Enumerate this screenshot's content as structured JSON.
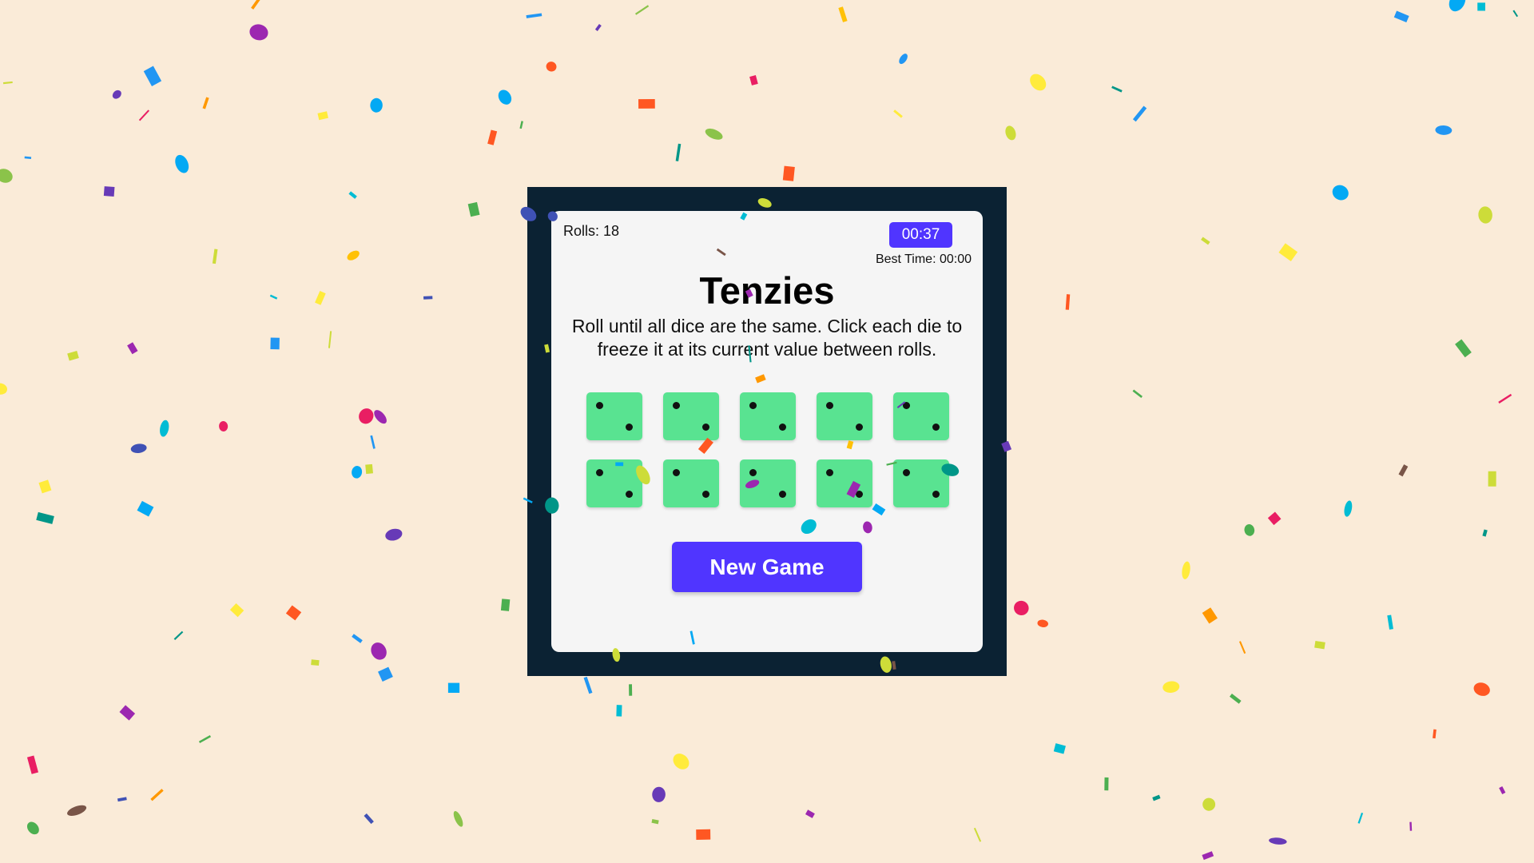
{
  "game": {
    "rolls_label": "Rolls: 18",
    "timer": "00:37",
    "best_time_label": "Best Time: 00:00",
    "title": "Tenzies",
    "instructions": "Roll until all dice are the same. Click each die to freeze it at its current value between rolls.",
    "new_game_label": "New Game"
  },
  "dice": [
    {
      "value": 2,
      "held": true
    },
    {
      "value": 2,
      "held": true
    },
    {
      "value": 2,
      "held": true
    },
    {
      "value": 2,
      "held": true
    },
    {
      "value": 2,
      "held": true
    },
    {
      "value": 2,
      "held": true
    },
    {
      "value": 2,
      "held": true
    },
    {
      "value": 2,
      "held": true
    },
    {
      "value": 2,
      "held": true
    },
    {
      "value": 2,
      "held": true
    }
  ],
  "colors": {
    "page_background": "#faebd8",
    "frame": "#0b2233",
    "card": "#f5f5f5",
    "accent": "#5035ff",
    "die_held": "#59e391",
    "pip": "#111111"
  },
  "confetti_palette": [
    "#e91e63",
    "#9c27b0",
    "#673ab7",
    "#3f51b5",
    "#2196f3",
    "#03a9f4",
    "#00bcd4",
    "#009688",
    "#4caf50",
    "#8bc34a",
    "#cddc39",
    "#ffeb3b",
    "#ffc107",
    "#ff9800",
    "#ff5722",
    "#795548"
  ]
}
